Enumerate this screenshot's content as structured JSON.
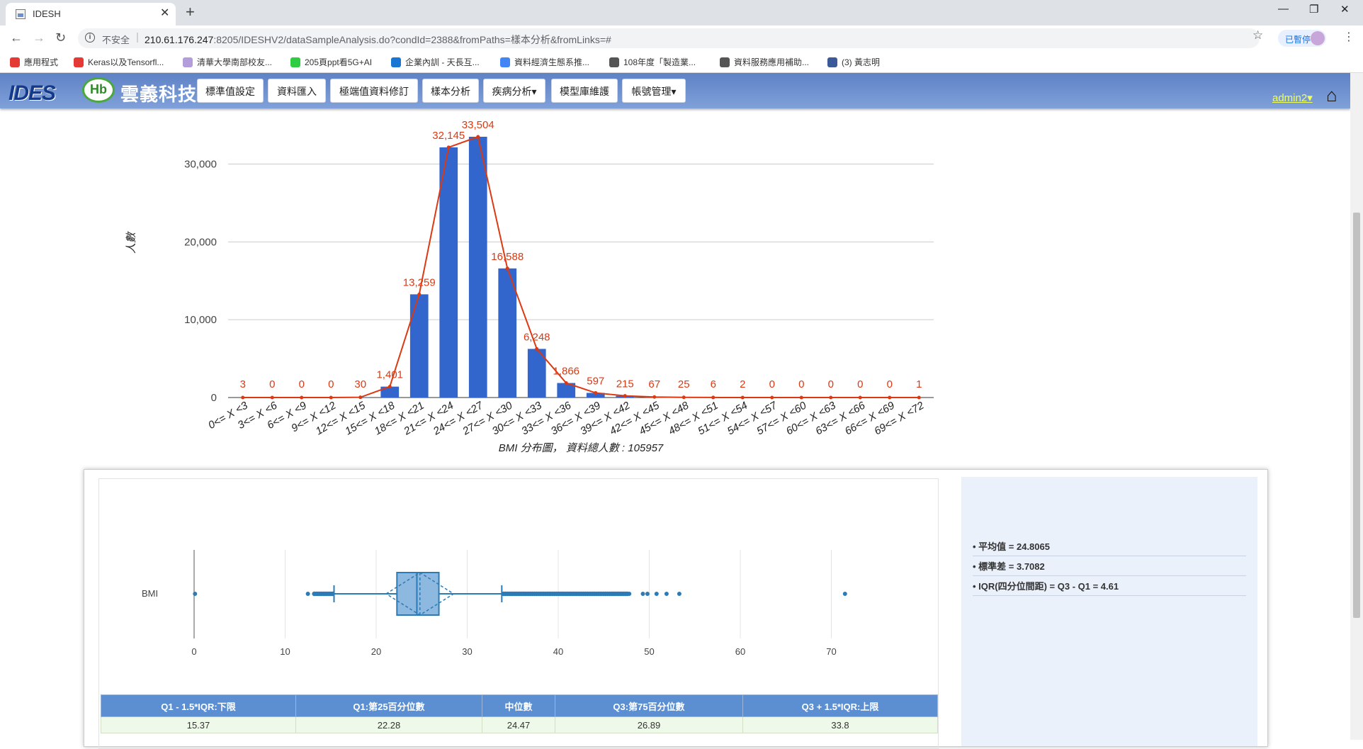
{
  "browser": {
    "tab_title": "IDESH",
    "tab_close": "✕",
    "new_tab": "+",
    "window_minimize": "—",
    "window_restore": "❐",
    "window_close": "✕",
    "insecure_label": "不安全",
    "url_host": "210.61.176.247",
    "url_rest": ":8205/IDESHV2/dataSampleAnalysis.do?condId=2388&fromPaths=樣本分析&fromLinks=#",
    "paused_label": "已暫停",
    "bookmarks": [
      "應用程式",
      "Keras以及Tensorfl...",
      "清華大學南部校友...",
      "205頁ppt看5G+AI",
      "企業內訓 - 天長互...",
      "資料經濟生態系推...",
      "108年度「製造業...",
      "資料服務應用補助...",
      "(3) 黃志明"
    ],
    "bookmark_colors": [
      "#e53935",
      "#e53935",
      "#b39ddb",
      "#2ecc40",
      "#1976d2",
      "#4285f4",
      "#555555",
      "#555555",
      "#3b5998"
    ]
  },
  "nav": {
    "logo_ides": "IDES",
    "logo_hb": "Hb",
    "brand": "雲義科技",
    "buttons": [
      "標準值設定",
      "資料匯入",
      "極端值資料修訂",
      "樣本分析",
      "疾病分析▾",
      "模型庫維護",
      "帳號管理▾"
    ],
    "user": "admin2▾",
    "home_icon": "home-icon"
  },
  "chart_data": [
    {
      "type": "bar",
      "title": "BMI 分布圖， 資料總人數 : 105957",
      "ylabel": "人數",
      "ylim": [
        0,
        33504
      ],
      "yticks": [
        "0",
        "10,000",
        "20,000",
        "30,000"
      ],
      "ytick_values": [
        0,
        10000,
        20000,
        30000
      ],
      "categories": [
        "0<= X <3",
        "3<= X <6",
        "6<= X <9",
        "9<= X <12",
        "12<= X <15",
        "15<= X <18",
        "18<= X <21",
        "21<= X <24",
        "24<= X <27",
        "27<= X <30",
        "30<= X <33",
        "33<= X <36",
        "36<= X <39",
        "39<= X <42",
        "42<= X <45",
        "45<= X <48",
        "48<= X <51",
        "51<= X <54",
        "54<= X <57",
        "57<= X <60",
        "60<= X <63",
        "63<= X <66",
        "66<= X <69",
        "69<= X <72"
      ],
      "values": [
        3,
        0,
        0,
        0,
        30,
        1401,
        13259,
        32145,
        33504,
        16588,
        6248,
        1866,
        597,
        215,
        67,
        25,
        6,
        2,
        0,
        0,
        0,
        0,
        0,
        1
      ],
      "value_labels": [
        "3",
        "0",
        "0",
        "0",
        "30",
        "1,401",
        "13,259",
        "32,145",
        "33,504",
        "16,588",
        "6,248",
        "1,866",
        "597",
        "215",
        "67",
        "25",
        "6",
        "2",
        "0",
        "0",
        "0",
        "0",
        "0",
        "1"
      ],
      "bar_color": "#3366cc",
      "line_color": "#dc3912",
      "grid": true
    },
    {
      "type": "box",
      "category": "BMI",
      "xticks": [
        0,
        10,
        20,
        30,
        40,
        50,
        60,
        70
      ],
      "q1": 22.28,
      "median": 24.47,
      "q3": 26.89,
      "mean": 24.8065,
      "std": 3.7082,
      "lower_fence": 15.37,
      "upper_fence": 33.8,
      "outliers": [
        0.1,
        12.5,
        13.2,
        13.5,
        13.8,
        14.1,
        14.4,
        14.7,
        15.0,
        34.0,
        34.5,
        35,
        36,
        37,
        38,
        39,
        40,
        41,
        42,
        43,
        44,
        45,
        46,
        47,
        47.8,
        49.3,
        49.8,
        50.8,
        51.9,
        53.3,
        71.5
      ],
      "color": "#2c7bb6"
    }
  ],
  "stats": {
    "items": [
      "平均值 = 24.8065",
      "標準差 = 3.7082",
      "IQR(四分位間距) = Q3 - Q1 = 4.61"
    ]
  },
  "quartiles_table": {
    "headers": [
      "Q1 - 1.5*IQR:下限",
      "Q1:第25百分位數",
      "中位數",
      "Q3:第75百分位數",
      "Q3 + 1.5*IQR:上限"
    ],
    "row": [
      "15.37",
      "22.28",
      "24.47",
      "26.89",
      "33.8"
    ]
  }
}
